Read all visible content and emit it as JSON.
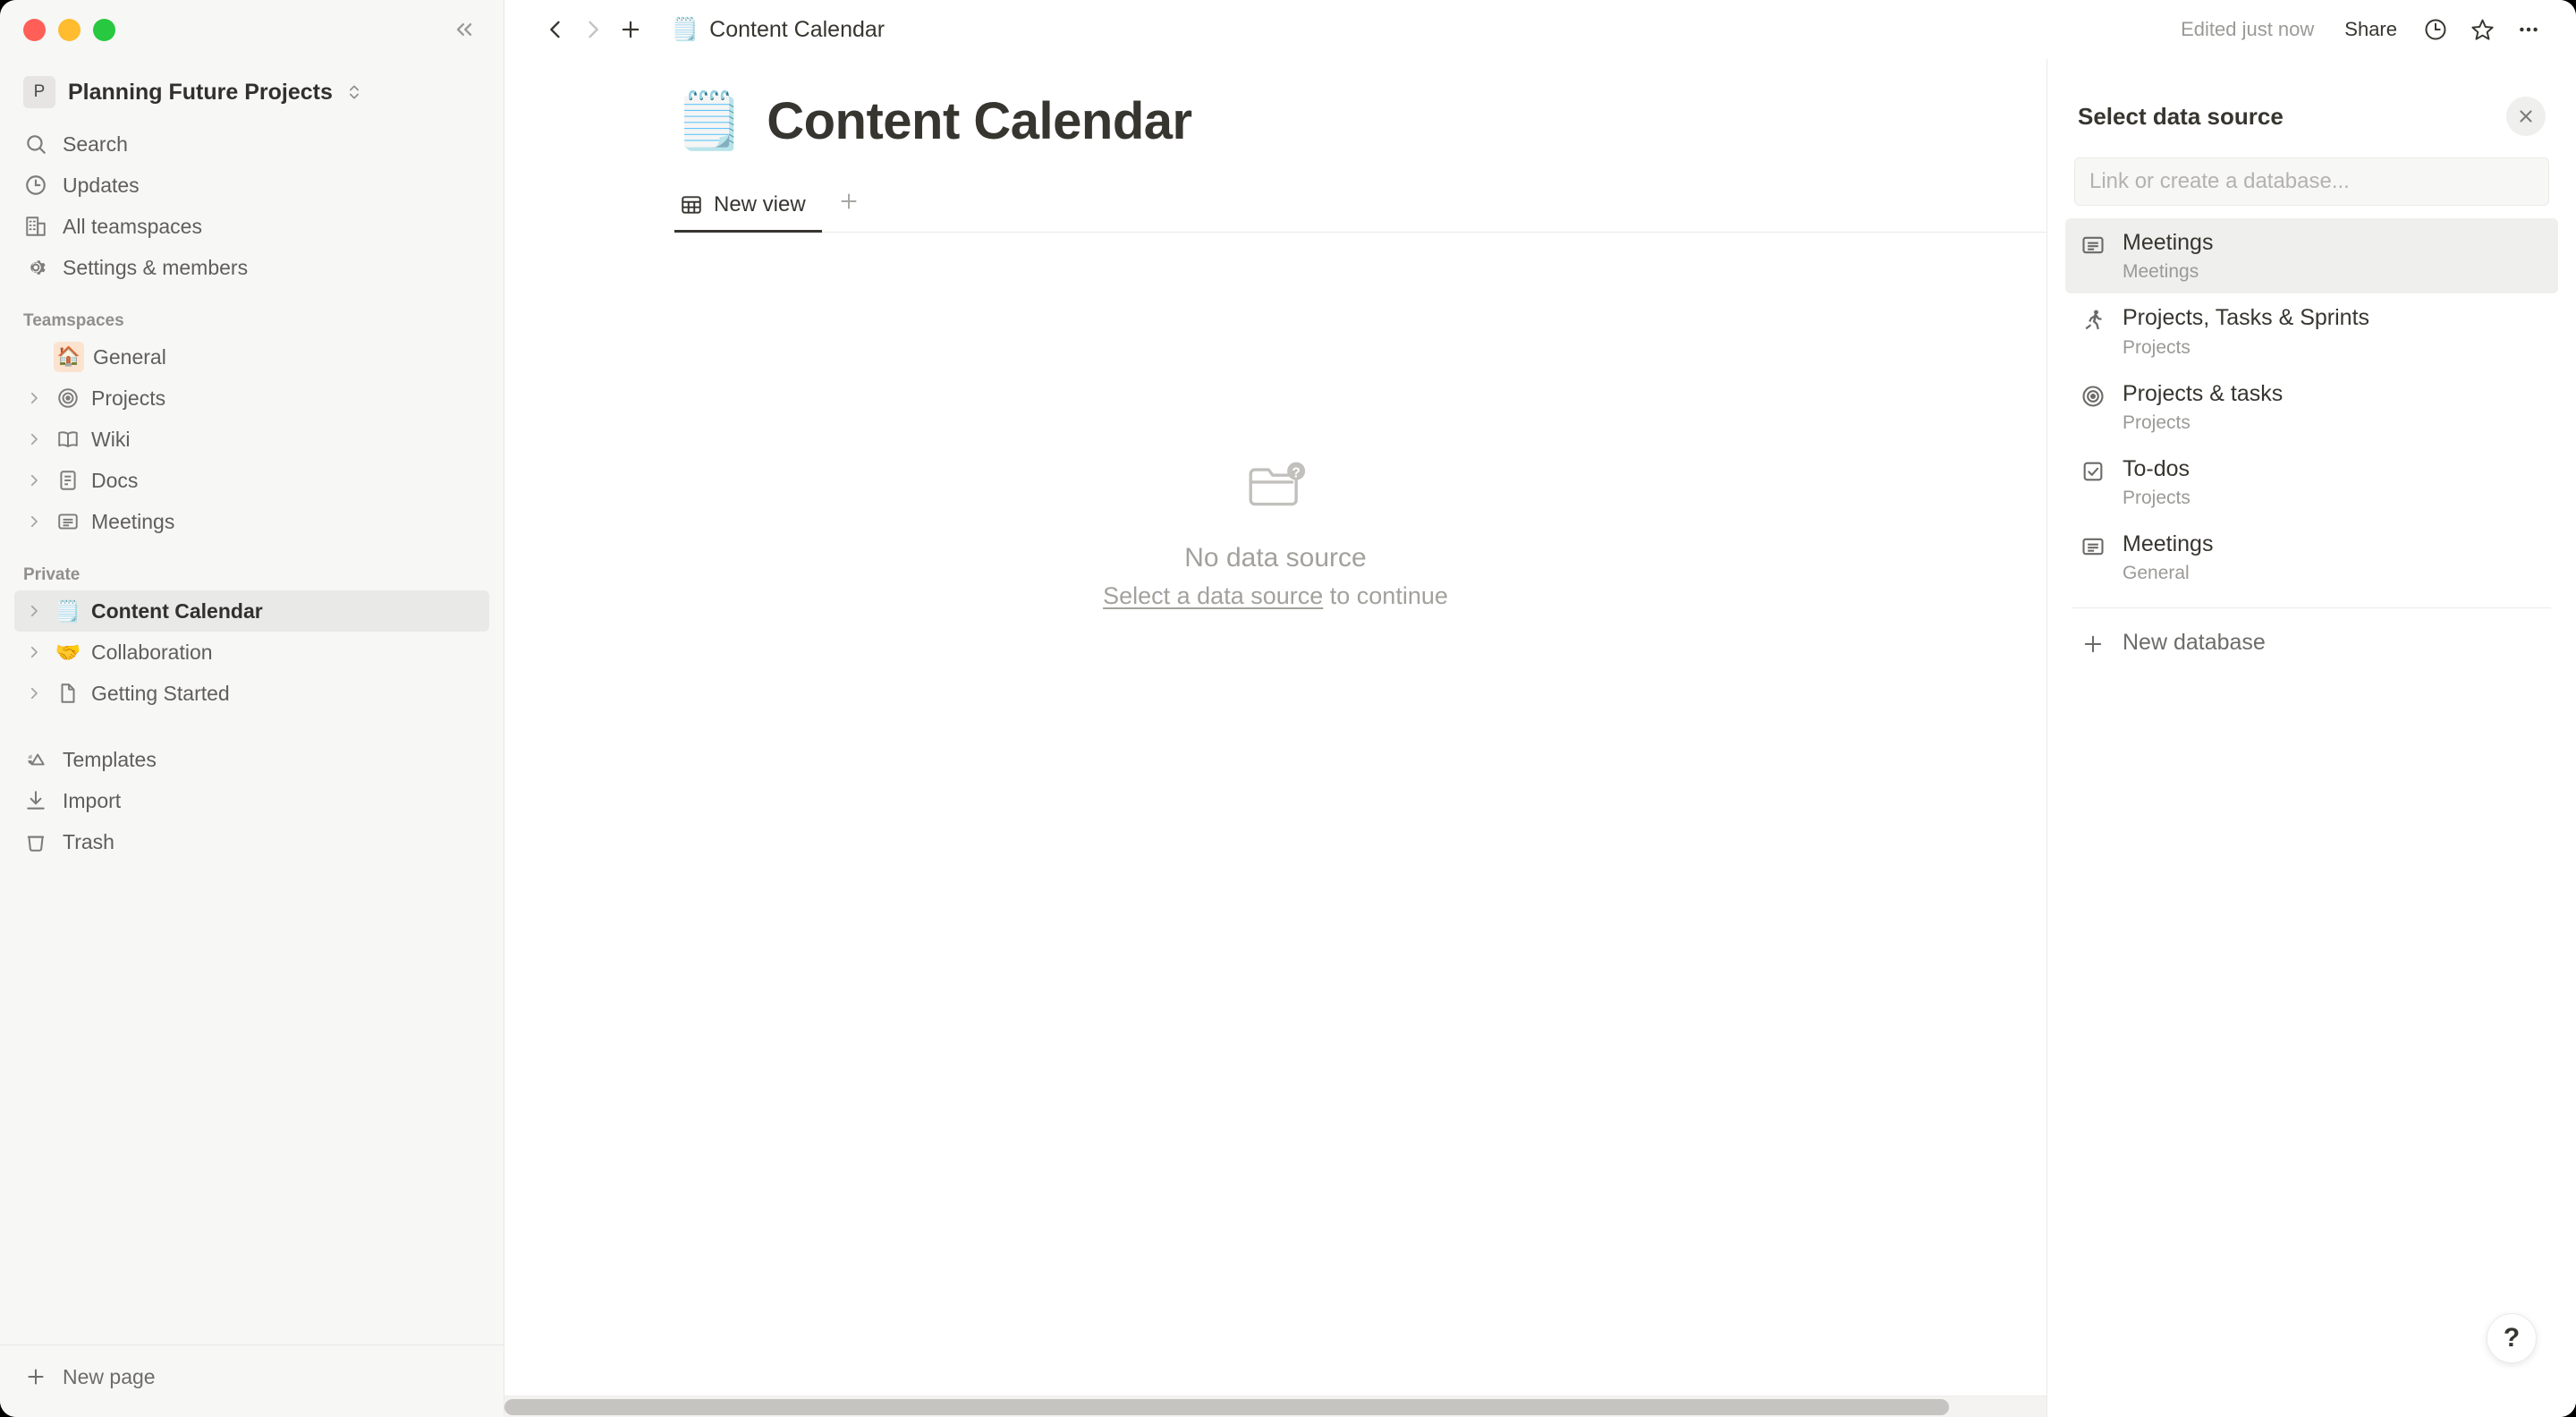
{
  "window": {
    "traffic_lights": [
      "close",
      "minimize",
      "maximize"
    ],
    "collapse_label": "«"
  },
  "sidebar": {
    "workspace": {
      "badge": "P",
      "name": "Planning Future Projects"
    },
    "nav": [
      {
        "icon": "search-icon",
        "label": "Search"
      },
      {
        "icon": "clock-icon",
        "label": "Updates"
      },
      {
        "icon": "building-icon",
        "label": "All teamspaces"
      },
      {
        "icon": "gear-icon",
        "label": "Settings & members"
      }
    ],
    "teamspaces_header": "Teamspaces",
    "teamspaces": [
      {
        "emoji": "🏠",
        "label": "General",
        "twisty": false,
        "boxed": true
      },
      {
        "icon": "target-icon",
        "label": "Projects",
        "twisty": true
      },
      {
        "icon": "book-icon",
        "label": "Wiki",
        "twisty": true
      },
      {
        "icon": "doc-icon",
        "label": "Docs",
        "twisty": true
      },
      {
        "icon": "note-icon",
        "label": "Meetings",
        "twisty": true
      }
    ],
    "private_header": "Private",
    "private": [
      {
        "emoji": "🗒️",
        "label": "Content Calendar",
        "twisty": true,
        "selected": true
      },
      {
        "emoji": "🤝",
        "label": "Collaboration",
        "twisty": true,
        "selected": false
      },
      {
        "icon": "page-icon",
        "label": "Getting Started",
        "twisty": true,
        "selected": false
      }
    ],
    "tools": [
      {
        "icon": "templates-icon",
        "label": "Templates"
      },
      {
        "icon": "import-icon",
        "label": "Import"
      },
      {
        "icon": "trash-icon",
        "label": "Trash"
      }
    ],
    "new_page_label": "New page"
  },
  "topbar": {
    "back_icon": "chevron-left-icon",
    "forward_icon": "chevron-right-icon",
    "add_icon": "plus-icon",
    "breadcrumb_emoji": "🗒️",
    "breadcrumb": "Content Calendar",
    "edited": "Edited just now",
    "share_label": "Share",
    "history_icon": "clock-icon",
    "favorite_icon": "star-icon",
    "more_icon": "ellipsis-icon"
  },
  "page": {
    "emoji": "🗒️",
    "title": "Content Calendar",
    "tabs": [
      {
        "icon": "table-icon",
        "label": "New view",
        "active": true
      }
    ],
    "add_view_icon": "plus-icon"
  },
  "empty_state": {
    "icon": "folder-question-icon",
    "title": "No data source",
    "link_text": "Select a data source",
    "suffix_text": " to continue"
  },
  "panel": {
    "title": "Select data source",
    "close_icon": "close-icon",
    "search_value": "",
    "search_placeholder": "Link or create a database...",
    "items": [
      {
        "icon": "note-icon",
        "name": "Meetings",
        "parent": "Meetings",
        "highlighted": true
      },
      {
        "icon": "runner-icon",
        "name": "Projects, Tasks & Sprints",
        "parent": "Projects",
        "highlighted": false
      },
      {
        "icon": "target-icon",
        "name": "Projects & tasks",
        "parent": "Projects",
        "highlighted": false
      },
      {
        "icon": "checkbox-icon",
        "name": "To-dos",
        "parent": "Projects",
        "highlighted": false
      },
      {
        "icon": "note-icon",
        "name": "Meetings",
        "parent": "General",
        "highlighted": false
      }
    ],
    "new_database_label": "New database",
    "new_database_icon": "plus-icon"
  },
  "help": {
    "label": "?"
  },
  "colors": {
    "sidebar_bg": "#f7f7f5",
    "selected_bg": "#e9e9e7",
    "text_primary": "#37352f",
    "text_muted": "#9b9a97",
    "traffic_red": "#ff5f57",
    "traffic_yellow": "#febc2e",
    "traffic_green": "#28c840"
  }
}
